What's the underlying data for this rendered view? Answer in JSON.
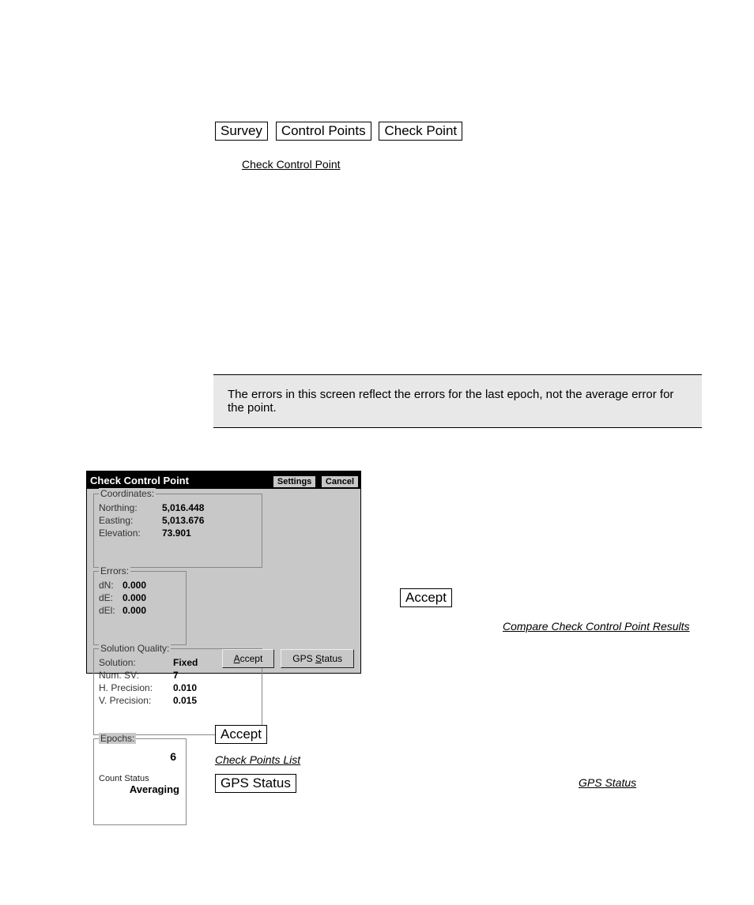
{
  "header": {
    "btn1": "Survey",
    "btn2": "Control Points",
    "btn3": "Check Point"
  },
  "step2_link": "Check Control Point",
  "note_text": "The errors in this screen reflect the errors for the last epoch, not the average error for the point.",
  "dialog": {
    "title": "Check Control Point",
    "settings": "Settings",
    "cancel": "Cancel",
    "coords_legend": "Coordinates:",
    "northing_lab": "Northing:",
    "northing_val": "5,016.448",
    "easting_lab": "Easting:",
    "easting_val": "5,013.676",
    "elev_lab": "Elevation:",
    "elev_val": "73.901",
    "errors_legend": "Errors:",
    "dn_lab": "dN:",
    "dn_val": "0.000",
    "de_lab": "dE:",
    "de_val": "0.000",
    "del_lab": "dEl:",
    "del_val": "0.000",
    "sq_legend": "Solution Quality:",
    "sol_lab": "Solution:",
    "sol_val": "Fixed",
    "sv_lab": "Num. SV:",
    "sv_val": "7",
    "hp_lab": "H. Precision:",
    "hp_val": "0.010",
    "vp_lab": "V. Precision:",
    "vp_val": "0.015",
    "ep_legend": "Epochs:",
    "ep_val": "6",
    "cs_lab": "Count Status",
    "cs_val": "Averaging",
    "accept_btn": "Accept",
    "accept_hotkey": "A",
    "gps_btn": "GPS Status",
    "gps_hotkey": "S"
  },
  "inline_accept": "Accept",
  "inline_ref_ccp": "Compare Check Control Point Results",
  "accept_btn2": "Accept",
  "accept_ref2": "Check Points List",
  "gps_btn2": "GPS Status",
  "gps_ref": "GPS Status"
}
